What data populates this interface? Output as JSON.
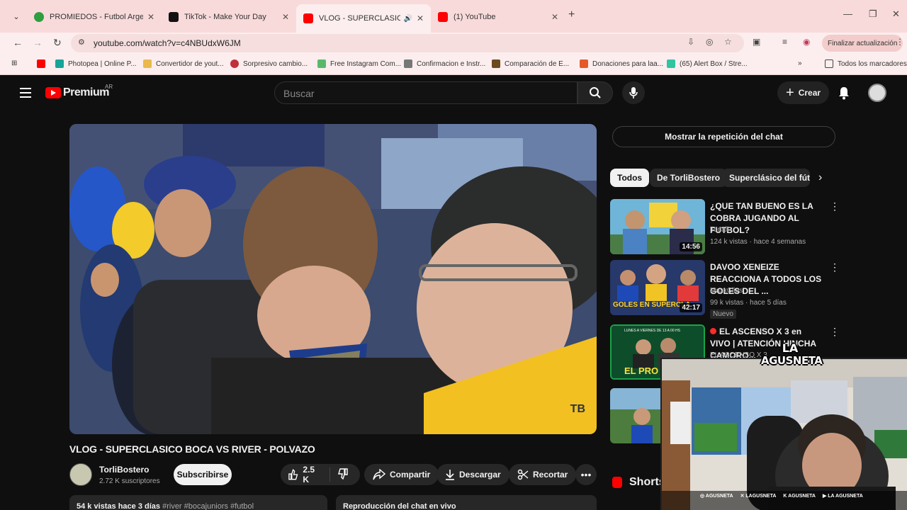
{
  "browser": {
    "tabs": [
      {
        "title": "PROMIEDOS - Futbol Argentina",
        "color": "#2e9e3e"
      },
      {
        "title": "TikTok - Make Your Day",
        "color": "#111111"
      },
      {
        "title": "VLOG - SUPERCLASICO BOCA",
        "color": "#ff0000",
        "active": true
      },
      {
        "title": "(1) YouTube",
        "color": "#ff0000"
      }
    ],
    "url": "youtube.com/watch?v=c4NBUdxW6JM",
    "update_label": "Finalizar actualización",
    "bookmarks": [
      "Photopea | Online P...",
      "Convertidor de yout...",
      "Sorpresivo cambio...",
      "Free Instagram Com...",
      "Confirmacion e Instr...",
      "Comparación de E...",
      "Donaciones para laa...",
      "(65) Alert Box / Stre..."
    ],
    "all_bookmarks": "Todos los marcadores"
  },
  "header": {
    "logo_word": "Premium",
    "country": "AR",
    "search_placeholder": "Buscar",
    "create_label": "Crear"
  },
  "video": {
    "title": "VLOG - SUPERCLASICO BOCA VS RIVER - POLVAZO",
    "watermark": "TB",
    "channel": "TorliBostero",
    "subscribers": "2.72 K suscriptores",
    "subscribe": "Subscribirse",
    "likes": "2.5 K",
    "share": "Compartir",
    "download": "Descargar",
    "clip": "Recortar",
    "desc_meta": "54 k vistas  hace 3 días",
    "desc_tags": "#river #bocajuniors #futbol",
    "chat_replay_caption": "Reproducción del chat en vivo"
  },
  "sidebar": {
    "chat_replay": "Mostrar la repetición del chat",
    "chips": [
      "Todos",
      "De TorliBostero",
      "Superclásico del fútbol"
    ],
    "recs": [
      {
        "title": "¿QUE TAN BUENO ES LA COBRA JUGANDO AL FUTBOL?",
        "channel": "Tonali",
        "meta": "124 k vistas · hace 4 semanas",
        "duration": "14:56"
      },
      {
        "title": "DAVOO XENEIZE REACCIONA A TODOS LOS GOLES DEL ...",
        "channel": "MaxxClips",
        "meta": "99 k vistas · hace 5 días",
        "duration": "42:17",
        "badge": "Nuevo",
        "thumb_text": "GOLES EN SUPERCLA"
      },
      {
        "title": "EL ASCENSO X 3 en VIVO | ATENCIÓN HINCHA CAMORO...",
        "channel": "EL ASCENSO X 3",
        "meta": "",
        "duration": "",
        "thumb_text": "EL PRO",
        "thumb_top": "LUNES A VIERNES DE 13 A 00 HS",
        "live": true
      }
    ],
    "shorts": "Shorts"
  },
  "cam": {
    "logo_line1": "LA",
    "logo_line2": "AGUSNETA",
    "social": [
      "AGUSNETA",
      "LAGUSNETA",
      "AGUSNETA",
      "LA AGUSNETA"
    ]
  }
}
